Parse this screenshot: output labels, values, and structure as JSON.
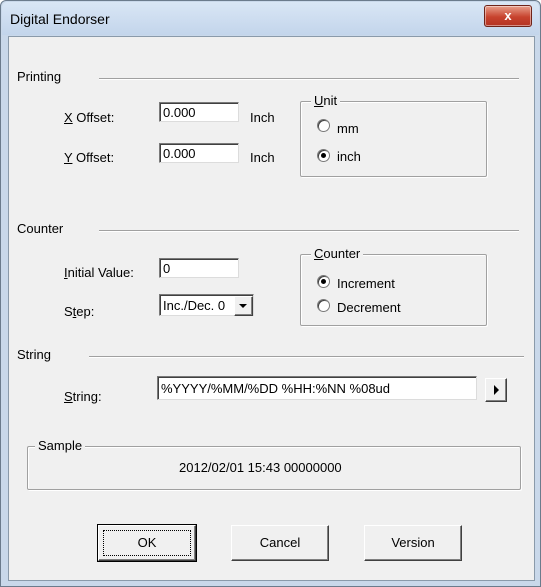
{
  "window": {
    "title": "Digital Endorser",
    "close_glyph": "x"
  },
  "printing": {
    "label": "Printing",
    "x_offset": {
      "label_key": "X",
      "label_rest": " Offset:",
      "value": "0.000",
      "unit": "Inch"
    },
    "y_offset": {
      "label_key": "Y",
      "label_rest": " Offset:",
      "value": "0.000",
      "unit": "Inch"
    },
    "unit_group": {
      "title_key": "U",
      "title_rest": "nit",
      "options": [
        {
          "label": "mm",
          "selected": false
        },
        {
          "label": "inch",
          "selected": true
        }
      ]
    }
  },
  "counter": {
    "label": "Counter",
    "initial_value": {
      "label_key": "I",
      "label_rest": "nitial Value:",
      "value": "0"
    },
    "step": {
      "label_pre": "S",
      "label_key": "t",
      "label_rest": "ep:",
      "value": "Inc./Dec. 0"
    },
    "counter_group": {
      "title_key": "C",
      "title_rest": "ounter",
      "options": [
        {
          "label": "Increment",
          "selected": true
        },
        {
          "label": "Decrement",
          "selected": false
        }
      ]
    }
  },
  "string": {
    "label": "String",
    "field": {
      "label_key": "S",
      "label_rest": "tring:",
      "value": "%YYYY/%MM/%DD %HH:%NN %08ud"
    }
  },
  "sample": {
    "title": "Sample",
    "value": "2012/02/01 15:43 00000000"
  },
  "buttons": {
    "ok": "OK",
    "cancel": "Cancel",
    "version": "Version"
  },
  "icons": {
    "close": "close-icon",
    "combo": "chevron-down-icon",
    "insert": "play-right-icon"
  }
}
